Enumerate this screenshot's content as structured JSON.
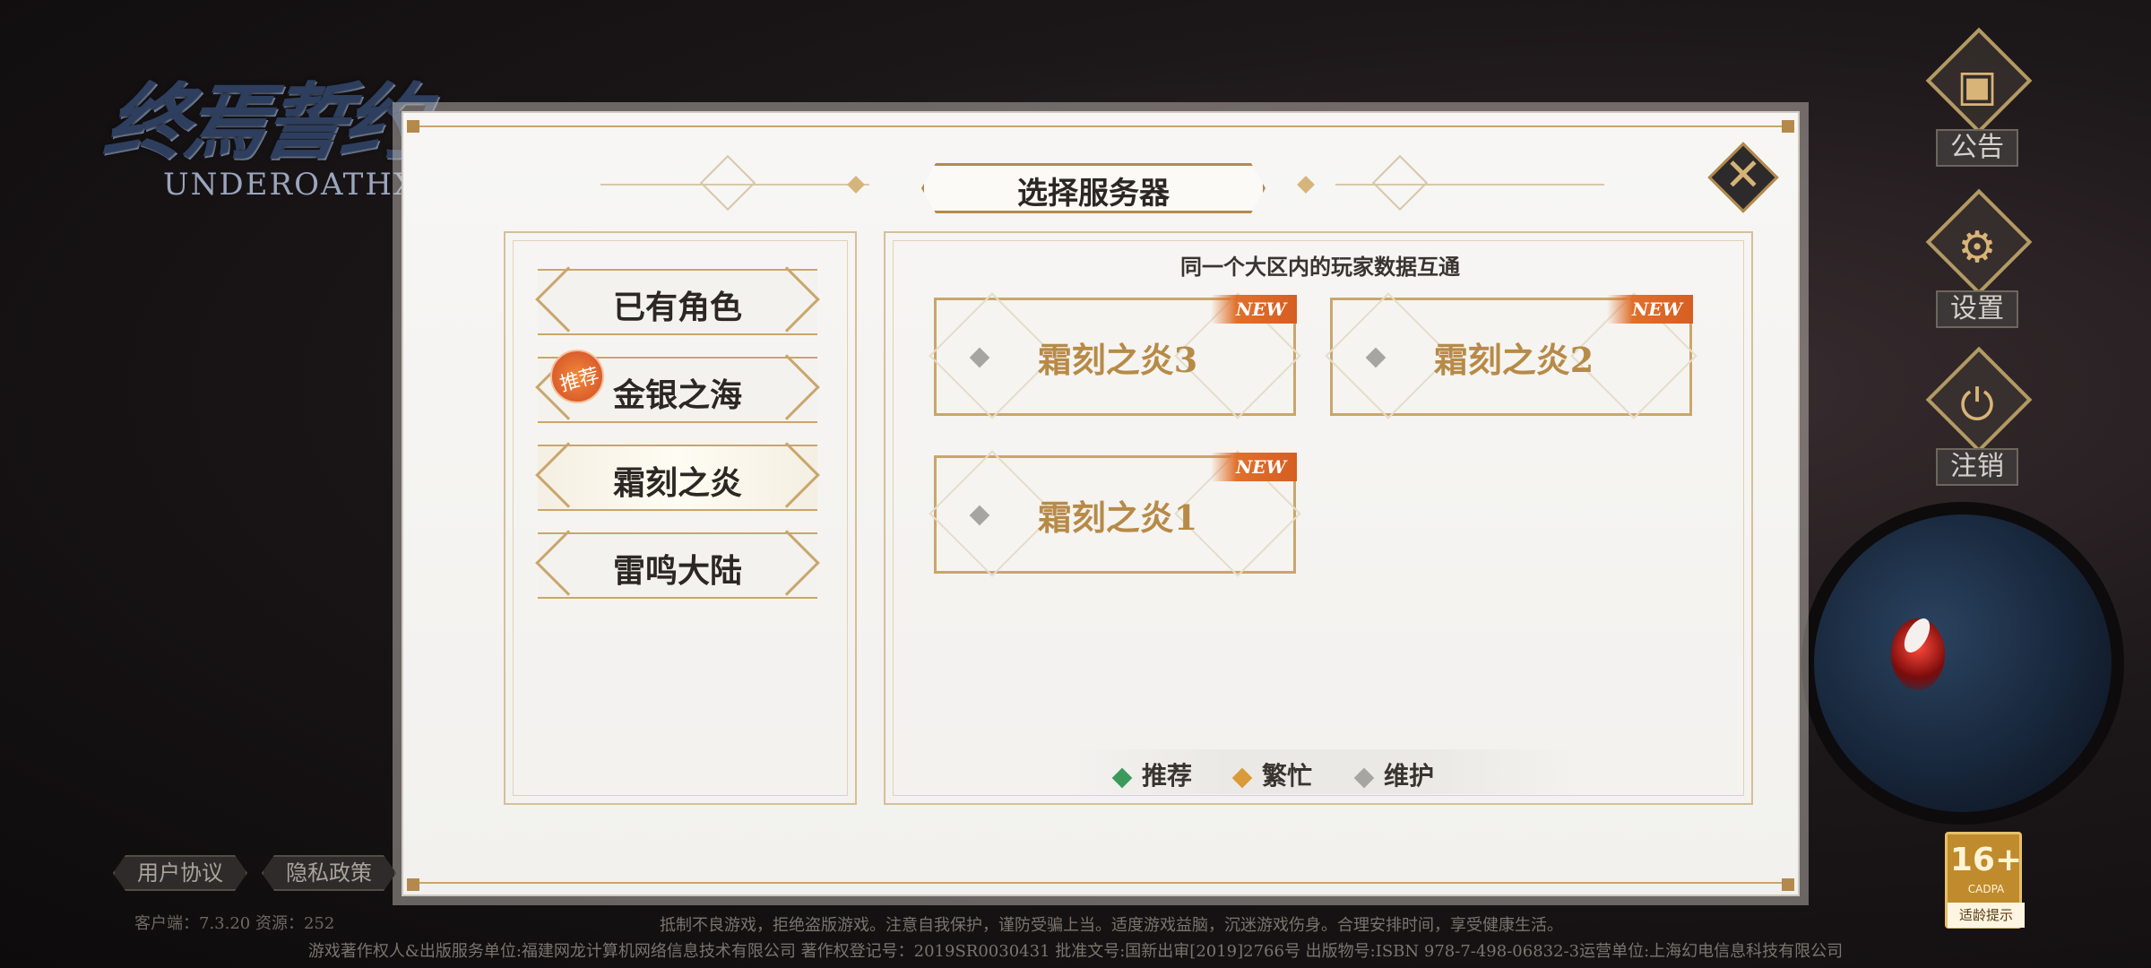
{
  "logo": {
    "title_cn": "终焉誓约",
    "title_en": "UNDEROATHX"
  },
  "dialog": {
    "title": "选择服务器",
    "hint": "同一个大区内的玩家数据互通"
  },
  "regions": [
    {
      "label": "已有角色",
      "badge": ""
    },
    {
      "label": "金银之海",
      "badge": "推荐"
    },
    {
      "label": "霜刻之炎",
      "badge": "",
      "active": true
    },
    {
      "label": "雷鸣大陆",
      "badge": ""
    }
  ],
  "servers": [
    {
      "name": "霜刻之炎3",
      "tag": "NEW",
      "status": "maintenance"
    },
    {
      "name": "霜刻之炎2",
      "tag": "NEW",
      "status": "maintenance"
    },
    {
      "name": "霜刻之炎1",
      "tag": "NEW",
      "status": "maintenance"
    }
  ],
  "legend": [
    {
      "label": "推荐",
      "color": "#3a9a5c"
    },
    {
      "label": "繁忙",
      "color": "#d99a3a"
    },
    {
      "label": "维护",
      "color": "#a7a5a2"
    }
  ],
  "side_menu": [
    {
      "label": "公告",
      "icon": "notice-board-icon"
    },
    {
      "label": "设置",
      "icon": "gear-icon"
    },
    {
      "label": "注销",
      "icon": "power-icon"
    }
  ],
  "footer": {
    "user_agreement": "用户协议",
    "privacy_policy": "隐私政策",
    "client_version": "客户端：7.3.20  资源：252",
    "line1": "抵制不良游戏，拒绝盗版游戏。注意自我保护，谨防受骗上当。适度游戏益脑，沉迷游戏伤身。合理安排时间，享受健康生活。",
    "line2": "游戏著作权人&出版服务单位:福建网龙计算机网络信息技术有限公司  著作权登记号：2019SR0030431  批准文号:国新出审[2019]2766号  出版物号:ISBN 978-7-498-06832-3运营单位:上海幻电信息科技有限公司"
  },
  "age_rating": {
    "number": "16+",
    "org": "CADPA",
    "tip": "适龄提示"
  },
  "colors": {
    "gold": "#c9a66b",
    "server_name": "#b78a47",
    "new_tag": "#e0702c"
  }
}
